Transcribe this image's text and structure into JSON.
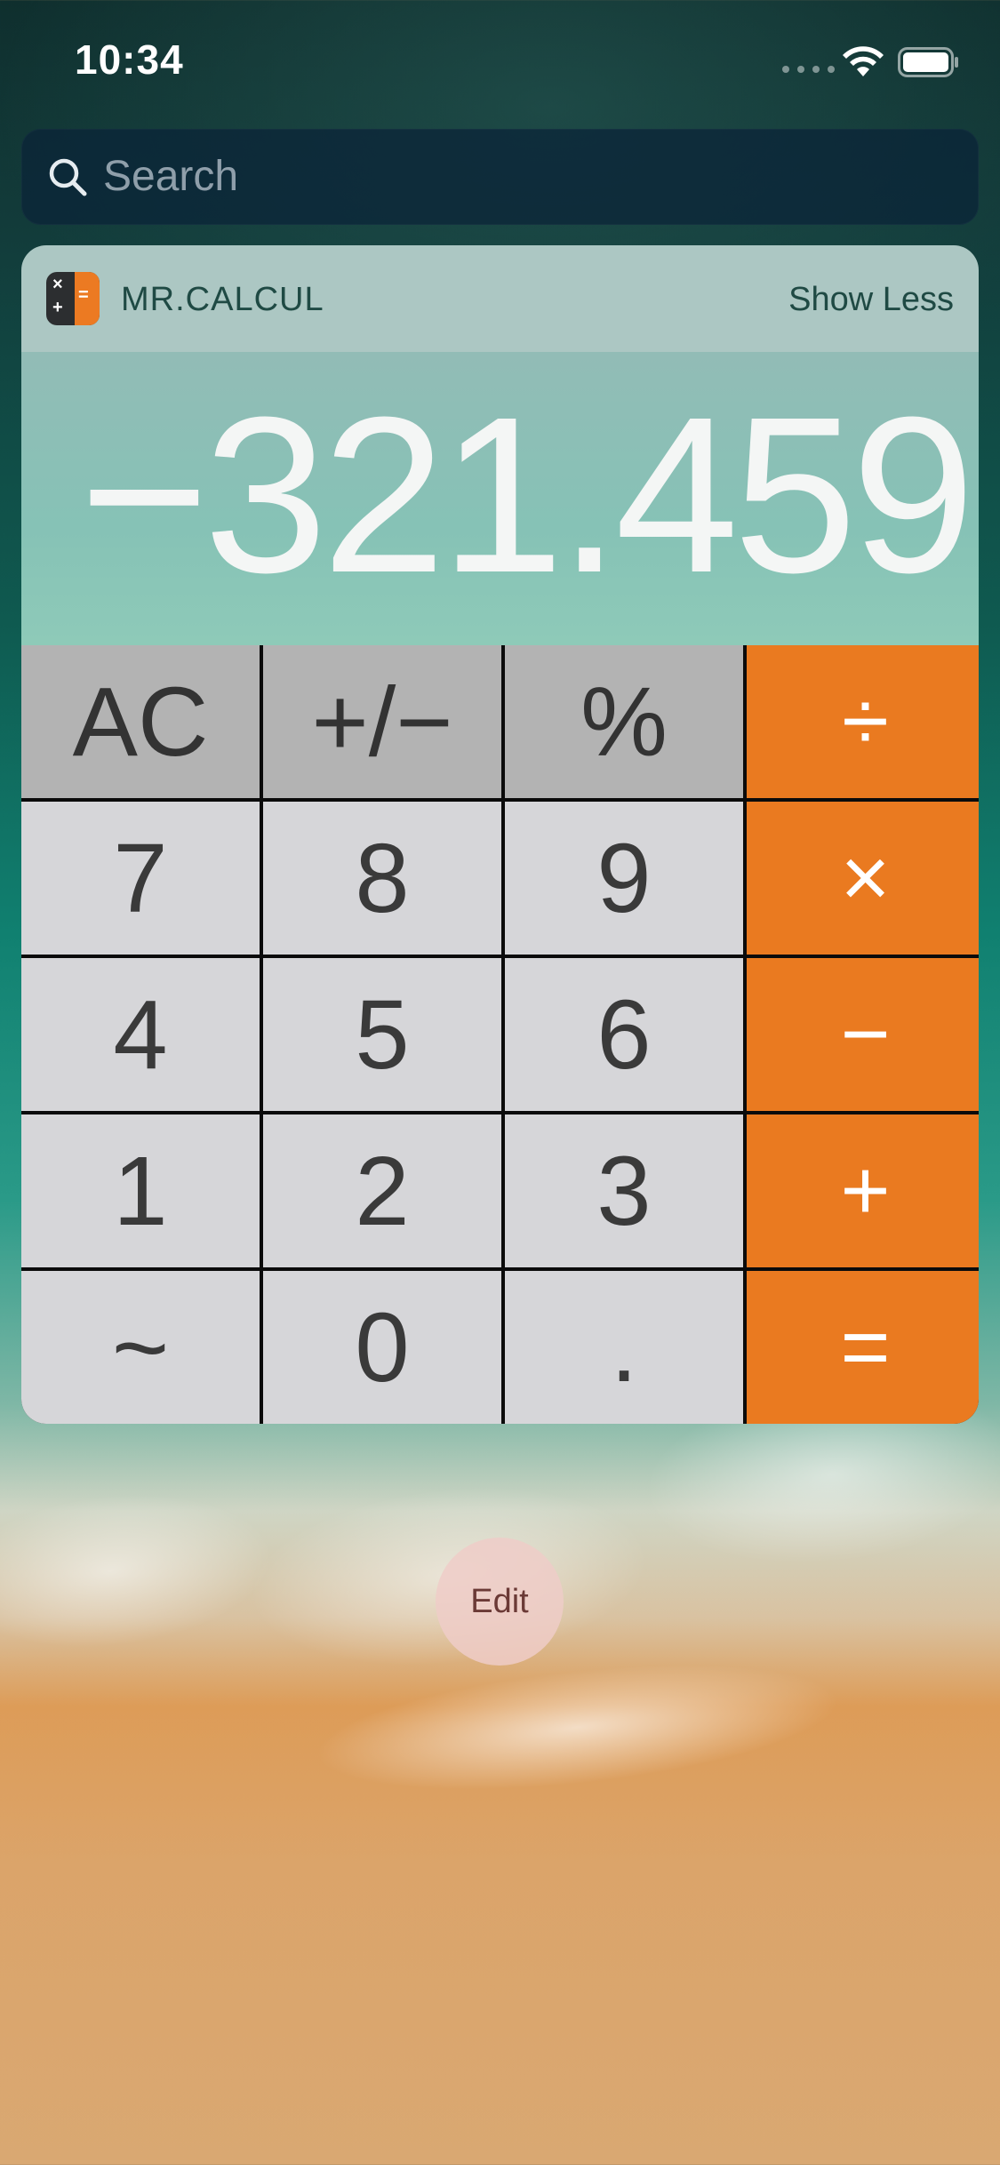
{
  "status_bar": {
    "time": "10:34",
    "icons": [
      "signal-dots-icon",
      "wifi-icon",
      "battery-icon"
    ]
  },
  "search": {
    "placeholder": "Search",
    "icon": "search-icon"
  },
  "widget": {
    "app_name": "MR.CALCUL",
    "show_less_label": "Show Less",
    "display_value": "−321.459",
    "colors": {
      "operator": "#ea7a20",
      "function_key": "#b3b3b3",
      "digit_key": "#d6d6d9",
      "header": "#acc7c3",
      "display": "#8ac4b7"
    },
    "keys": [
      {
        "label": "AC",
        "kind": "fn"
      },
      {
        "label": "+/−",
        "kind": "fn"
      },
      {
        "label": "%",
        "kind": "fn"
      },
      {
        "label": "÷",
        "kind": "op"
      },
      {
        "label": "7",
        "kind": "digit"
      },
      {
        "label": "8",
        "kind": "digit"
      },
      {
        "label": "9",
        "kind": "digit"
      },
      {
        "label": "×",
        "kind": "op"
      },
      {
        "label": "4",
        "kind": "digit"
      },
      {
        "label": "5",
        "kind": "digit"
      },
      {
        "label": "6",
        "kind": "digit"
      },
      {
        "label": "−",
        "kind": "op"
      },
      {
        "label": "1",
        "kind": "digit"
      },
      {
        "label": "2",
        "kind": "digit"
      },
      {
        "label": "3",
        "kind": "digit"
      },
      {
        "label": "+",
        "kind": "op"
      },
      {
        "label": "~",
        "kind": "digit"
      },
      {
        "label": "0",
        "kind": "digit"
      },
      {
        "label": ".",
        "kind": "digit"
      },
      {
        "label": "=",
        "kind": "op"
      }
    ]
  },
  "edit_label": "Edit"
}
